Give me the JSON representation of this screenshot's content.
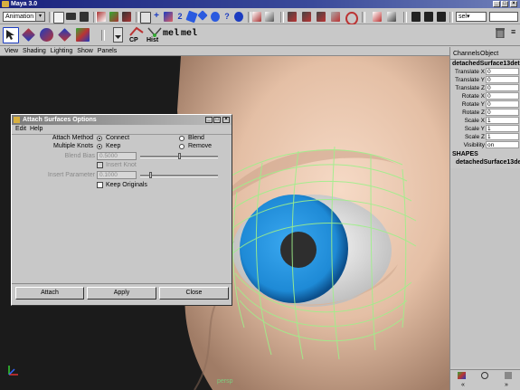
{
  "app": {
    "title": "Maya 3.0"
  },
  "statusline": {
    "menu_set": "Animation",
    "sel_label": "sel▾"
  },
  "shelf": {
    "cp_label": "CP",
    "hist_label": "Hist",
    "mel1_label": "mel",
    "mel2_label": "mel"
  },
  "panel_menu": {
    "items": [
      "View",
      "Shading",
      "Lighting",
      "Show",
      "Panels"
    ]
  },
  "viewport": {
    "camera_label": "persp"
  },
  "channel_box": {
    "header_channels": "Channels",
    "header_object": "Object",
    "object_name": "detachedSurface13deta",
    "channels": [
      {
        "label": "Translate X",
        "value": "0"
      },
      {
        "label": "Translate Y",
        "value": "0"
      },
      {
        "label": "Translate Z",
        "value": "0"
      },
      {
        "label": "Rotate X",
        "value": "0"
      },
      {
        "label": "Rotate Y",
        "value": "0"
      },
      {
        "label": "Rotate Z",
        "value": "0"
      },
      {
        "label": "Scale X",
        "value": "1"
      },
      {
        "label": "Scale Y",
        "value": "1"
      },
      {
        "label": "Scale Z",
        "value": "1"
      },
      {
        "label": "Visibility",
        "value": "on"
      }
    ],
    "shapes_header": "SHAPES",
    "shape_name": "detachedSurface13de"
  },
  "dialog": {
    "title": "Attach Surfaces Options",
    "menu": [
      "Edit",
      "Help"
    ],
    "attach_method_label": "Attach Method",
    "attach_method_options": [
      "Connect",
      "Blend"
    ],
    "multiple_knots_label": "Multiple Knots",
    "multiple_knots_options": [
      "Keep",
      "Remove"
    ],
    "blend_bias_label": "Blend Bias",
    "blend_bias_value": "0.5000",
    "insert_knot_label": "Insert Knot",
    "insert_parameter_label": "Insert Parameter",
    "insert_parameter_value": "0.1000",
    "keep_originals_label": "Keep Originals",
    "buttons": {
      "attach": "Attach",
      "apply": "Apply",
      "close": "Close"
    }
  },
  "colors": {
    "titlebar": "#1a237e",
    "panel": "#c8c8c8",
    "iris": "#1e8ad6",
    "wireframe": "#9ef08a"
  }
}
